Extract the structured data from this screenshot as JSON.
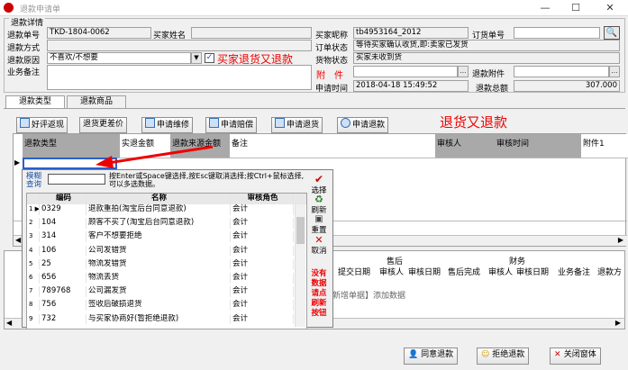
{
  "window": {
    "title": "退款申请单",
    "minimize": "—",
    "maximize": "☐",
    "close": "✕"
  },
  "section_title": "退款详情",
  "form": {
    "refund_no_label": "退款单号",
    "refund_no": "TKD-1804-0062",
    "buyer_name_label": "买家姓名",
    "buyer_name": "",
    "buyer_nick_label": "买家昵称",
    "buyer_nick": "tb4953164_2012",
    "order_no_label": "订货单号",
    "order_no": "",
    "refund_method_label": "退款方式",
    "refund_method": "",
    "order_status_label": "订单状态",
    "order_status": "等待买家确认收货,即:卖家已发货",
    "refund_reason_label": "退款原因",
    "refund_reason": "不喜欢/不想要",
    "checkbox_label": "买家退货又退款",
    "goods_status_label": "货物状态",
    "goods_status": "买家未收到货",
    "memo_label": "业务备注",
    "memo": "",
    "attachment_label": "附　件",
    "attachment": "",
    "refund_attachment_label": "退款附件",
    "refund_attachment": "",
    "apply_time_label": "申请时间",
    "apply_time": "2018-04-18 15:49:52",
    "refund_total_label": "退款总额",
    "refund_total": "307.000"
  },
  "tabs": [
    {
      "label": "退款类型"
    },
    {
      "label": "退款商品"
    }
  ],
  "toolbar": {
    "good_review": "好评返现",
    "change_price": "退货更差价",
    "repair": "申请维修",
    "compensation": "申请赔偿",
    "return": "申请退货",
    "refund": "申请退款"
  },
  "annotation": "退货又退款",
  "grid_headers": [
    "退款类型",
    "实退金额",
    "退款来源金额",
    "备注",
    "审核人",
    "审核时间",
    "附件1"
  ],
  "grid_row_marker": "▶",
  "popup": {
    "search_label": "模糊\n查询",
    "hint": "按Enter或Space键选择,按Esc键取消选择;按Ctrl+鼠标选择,可以多选数据。",
    "headers": [
      "编码",
      "名称",
      "审核角色"
    ],
    "rows": [
      {
        "marker": "1 ▶",
        "code": "0329",
        "name": "退款重拍(淘宝后台同意退款)",
        "role": "会计"
      },
      {
        "marker": "2",
        "code": "104",
        "name": "顾客不买了(淘宝后台同意退款)",
        "role": "会计"
      },
      {
        "marker": "3",
        "code": "314",
        "name": "客户不想要拒绝",
        "role": "会计"
      },
      {
        "marker": "4",
        "code": "106",
        "name": "公司发错货",
        "role": "会计"
      },
      {
        "marker": "5",
        "code": "25",
        "name": "物流发错货",
        "role": "会计"
      },
      {
        "marker": "6",
        "code": "656",
        "name": "物流丢货",
        "role": "会计"
      },
      {
        "marker": "7",
        "code": "789768",
        "name": "公司漏发货",
        "role": "会计"
      },
      {
        "marker": "8",
        "code": "756",
        "name": "签收后破损退货",
        "role": "会计"
      },
      {
        "marker": "9",
        "code": "732",
        "name": "与买家协商好(暂拒绝退款)",
        "role": "会计"
      }
    ],
    "select": "选择",
    "refresh": "刷新",
    "reset": "重置",
    "cancel": "取消",
    "no_data_note": "没有\n数据\n请点\n刷新\n按钮"
  },
  "lower_grid": {
    "after_sale": "售后",
    "finance": "财务",
    "cols": [
      "提交日期",
      "审核人",
      "审核日期",
      "售后完成",
      "审核人",
      "审核日期",
      "业务备注",
      "退款方"
    ],
    "add_hint": "新增单据】添加数据"
  },
  "bottom": {
    "agree": "同意退款",
    "reject": "拒绝退款",
    "close": "关闭窗体"
  },
  "colors": {
    "accent_red": "#e00000",
    "header_gray": "#a9a9a9"
  }
}
